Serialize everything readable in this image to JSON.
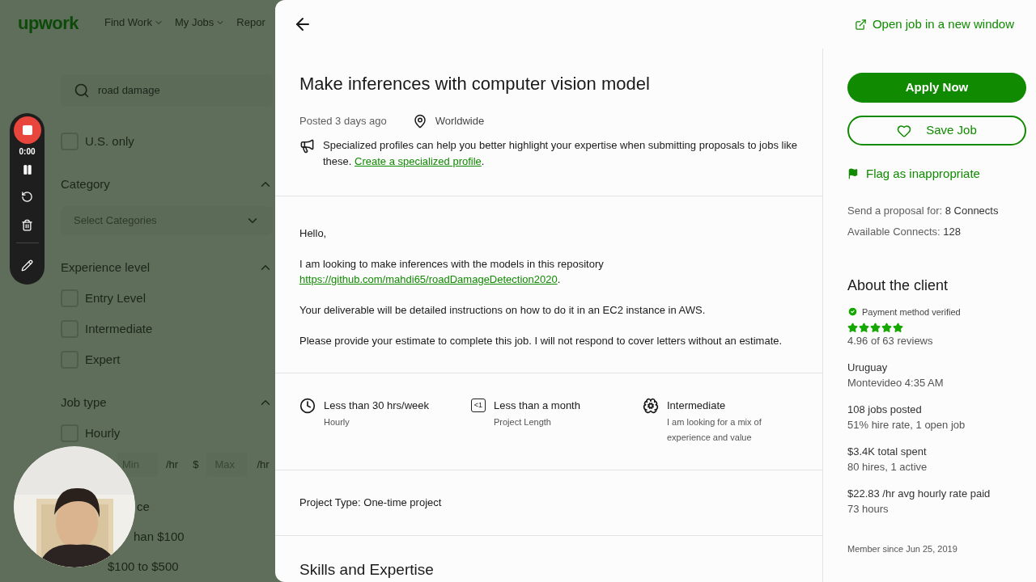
{
  "nav": {
    "logo": "upwork",
    "items": [
      "Find Work",
      "My Jobs",
      "Repor"
    ]
  },
  "search": {
    "value": "road damage"
  },
  "us_only": {
    "label": "U.S. only",
    "checked": false
  },
  "sections": [
    {
      "title": "Category",
      "expanded": true,
      "kind": "select",
      "placeholder": "Select Categories"
    },
    {
      "title": "Experience level",
      "expanded": true,
      "kind": "checks",
      "options": [
        {
          "label": "Entry Level",
          "checked": false
        },
        {
          "label": "Intermediate",
          "checked": false
        },
        {
          "label": "Expert",
          "checked": false
        }
      ]
    },
    {
      "title": "Job type",
      "expanded": true,
      "kind": "checks",
      "options": [
        {
          "label": "Hourly",
          "checked": false
        }
      ]
    }
  ],
  "rate": {
    "min_placeholder": "Min",
    "min_unit": "/hr",
    "currency": "$",
    "max_placeholder": "Max",
    "max_unit": "/hr"
  },
  "partial_options": [
    {
      "label": "ce"
    },
    {
      "label": "han $100"
    },
    {
      "label": "$100 to $500"
    }
  ],
  "recorder": {
    "time": "0:00"
  },
  "job": {
    "title": "Make inferences with computer vision model",
    "posted": "Posted 3 days ago",
    "location": "Worldwide",
    "notice": {
      "text": "Specialized profiles can help you better highlight your expertise when submitting proposals to jobs like these.",
      "link": "Create a specialized profile",
      "after": "."
    },
    "description": [
      {
        "text": "Hello,"
      },
      {
        "text": "I am looking to make inferences with the models in this repository",
        "link": "https://github.com/mahdi65/roadDamageDetection2020",
        "after": "."
      },
      {
        "text": "Your deliverable will be detailed instructions on how to do it in an EC2 instance in AWS."
      },
      {
        "text": "Please provide your estimate to complete this job. I will not respond to cover letters without an estimate."
      }
    ],
    "features": [
      {
        "kind": "clock",
        "title": "Less than 30 hrs/week",
        "subtitle": "Hourly"
      },
      {
        "kind": "calendar",
        "icon_label": "<1",
        "title": "Less than a month",
        "subtitle": "Project Length"
      },
      {
        "kind": "brain",
        "title": "Intermediate",
        "subtitle": "I am looking for a mix of experience and value"
      }
    ],
    "project_type": {
      "label": "Project Type:",
      "value": "One-time project"
    },
    "skills_heading": "Skills and Expertise"
  },
  "aside": {
    "open_link": "Open job in a new window",
    "apply": "Apply Now",
    "save": "Save Job",
    "flag": "Flag as inappropriate",
    "connects": [
      {
        "label": "Send a proposal for:",
        "value": "8 Connects"
      },
      {
        "label": "Available Connects:",
        "value": "128"
      }
    ],
    "client": {
      "heading": "About the client",
      "payment_verified": true,
      "payment_text": "Payment method verified",
      "stars": 5,
      "rating": "4.96 of 63 reviews",
      "groups": [
        {
          "title": "Uruguay",
          "detail": "Montevideo 4:35 AM"
        },
        {
          "title": "108 jobs posted",
          "detail": "51% hire rate, 1 open job"
        },
        {
          "title": "$3.4K total spent",
          "detail": "80 hires, 1 active"
        },
        {
          "title": "$22.83 /hr avg hourly rate paid",
          "detail": "73 hours"
        }
      ],
      "member": "Member since Jun 25, 2019"
    }
  }
}
